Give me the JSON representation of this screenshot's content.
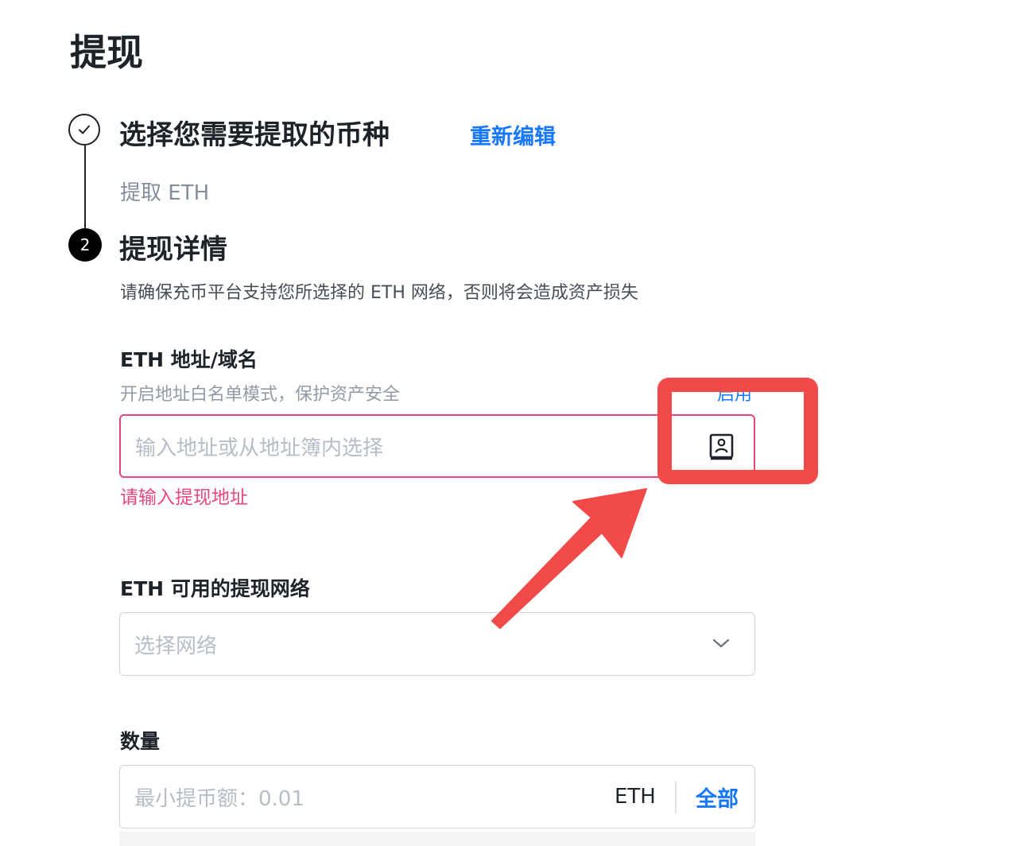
{
  "page": {
    "title": "提现"
  },
  "step1": {
    "title": "选择您需要提取的币种",
    "edit_link": "重新编辑",
    "summary": "提取 ETH"
  },
  "step2": {
    "number": "2",
    "title": "提现详情",
    "notice": "请确保充币平台支持您所选择的 ETH 网络，否则将会造成资产损失"
  },
  "address": {
    "label": "ETH 地址/域名",
    "whitelist_hint": "开启地址白名单模式，保护资产安全",
    "whitelist_action": "启用",
    "placeholder": "输入地址或从地址簿内选择",
    "error": "请输入提现地址",
    "address_book_icon": "address-book-icon"
  },
  "network": {
    "label": "ETH 可用的提现网络",
    "placeholder": "选择网络",
    "dropdown_icon": "chevron-down-icon"
  },
  "amount": {
    "label": "数量",
    "placeholder": "最小提币额：0.01",
    "unit": "ETH",
    "max_label": "全部"
  },
  "annotation": {
    "highlight_color": "#f24949"
  },
  "colors": {
    "accent": "#1677ff",
    "error": "#e8477a",
    "text": "#1e2329",
    "muted": "#848e9c"
  }
}
